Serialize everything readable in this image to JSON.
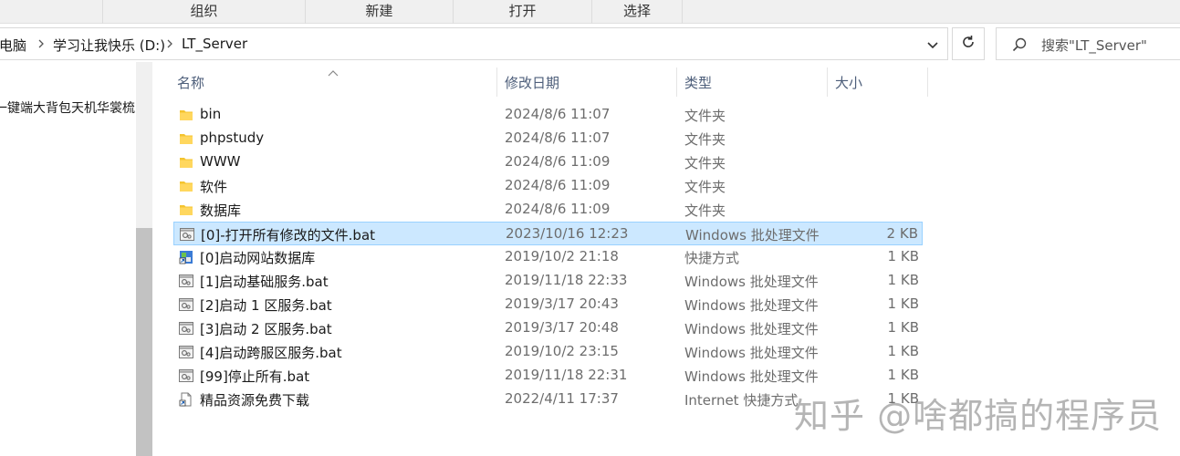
{
  "ribbon": {
    "groups": [
      "组织",
      "新建",
      "打开",
      "选择"
    ]
  },
  "address": {
    "crumbs": [
      "此电脑",
      "学习让我快乐 (D:)",
      "LT_Server"
    ]
  },
  "search": {
    "placeholder": "搜索\"LT_Server\""
  },
  "nav": {
    "item": "一键端大背包天机华裳梳"
  },
  "columns": {
    "name": "名称",
    "date": "修改日期",
    "type": "类型",
    "size": "大小"
  },
  "files": [
    {
      "name": "bin",
      "date": "2024/8/6 11:07",
      "type": "文件夹",
      "size": "",
      "icon": "folder-icon"
    },
    {
      "name": "phpstudy",
      "date": "2024/8/6 11:07",
      "type": "文件夹",
      "size": "",
      "icon": "folder-icon"
    },
    {
      "name": "WWW",
      "date": "2024/8/6 11:09",
      "type": "文件夹",
      "size": "",
      "icon": "folder-icon"
    },
    {
      "name": "软件",
      "date": "2024/8/6 11:09",
      "type": "文件夹",
      "size": "",
      "icon": "folder-icon"
    },
    {
      "name": "数据库",
      "date": "2024/8/6 11:09",
      "type": "文件夹",
      "size": "",
      "icon": "folder-icon"
    },
    {
      "name": "[0]-打开所有修改的文件.bat",
      "date": "2023/10/16 12:23",
      "type": "Windows 批处理文件",
      "size": "2 KB",
      "icon": "batch-file-icon",
      "selected": true
    },
    {
      "name": "[0]启动网站数据库",
      "date": "2019/10/2 21:18",
      "type": "快捷方式",
      "size": "1 KB",
      "icon": "shortcut-app-icon"
    },
    {
      "name": "[1]启动基础服务.bat",
      "date": "2019/11/18 22:33",
      "type": "Windows 批处理文件",
      "size": "1 KB",
      "icon": "batch-file-icon"
    },
    {
      "name": "[2]启动 1 区服务.bat",
      "date": "2019/3/17 20:43",
      "type": "Windows 批处理文件",
      "size": "1 KB",
      "icon": "batch-file-icon"
    },
    {
      "name": "[3]启动 2 区服务.bat",
      "date": "2019/3/17 20:48",
      "type": "Windows 批处理文件",
      "size": "1 KB",
      "icon": "batch-file-icon"
    },
    {
      "name": "[4]启动跨服区服务.bat",
      "date": "2019/10/2 23:15",
      "type": "Windows 批处理文件",
      "size": "1 KB",
      "icon": "batch-file-icon"
    },
    {
      "name": "[99]停止所有.bat",
      "date": "2019/11/18 22:31",
      "type": "Windows 批处理文件",
      "size": "1 KB",
      "icon": "batch-file-icon"
    },
    {
      "name": "精品资源免费下载",
      "date": "2022/4/11 17:37",
      "type": "Internet 快捷方式",
      "size": "1 KB",
      "icon": "internet-shortcut-icon"
    }
  ],
  "watermark": "知乎 @啥都搞的程序员",
  "colors": {
    "selection": "#cce8ff",
    "selection_border": "#99d1ff",
    "folder": "#f4c430",
    "header_text": "#4d5e7a"
  }
}
